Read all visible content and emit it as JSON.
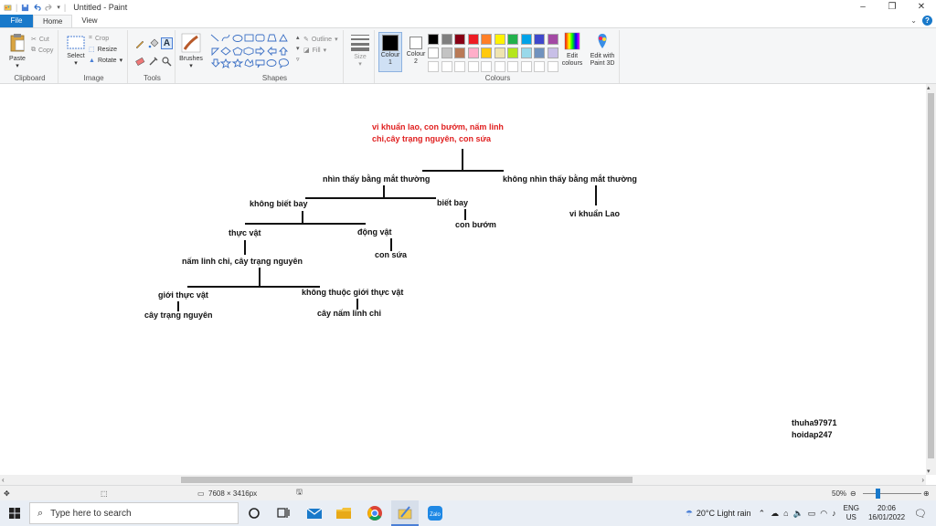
{
  "window": {
    "title": "Untitled - Paint",
    "minimize": "–",
    "restore": "❐",
    "close": "✕"
  },
  "tabs": {
    "file": "File",
    "home": "Home",
    "view": "View"
  },
  "ribbon": {
    "clipboard": {
      "label": "Clipboard",
      "paste": "Paste",
      "cut": "Cut",
      "copy": "Copy"
    },
    "image": {
      "label": "Image",
      "select": "Select",
      "crop": "Crop",
      "resize": "Resize",
      "rotate": "Rotate"
    },
    "tools": {
      "label": "Tools"
    },
    "brushes": "Brushes",
    "shapes": {
      "label": "Shapes",
      "outline": "Outline",
      "fill": "Fill"
    },
    "size": "Size",
    "colours": {
      "label": "Colours",
      "colour1": "Colour 1",
      "colour2": "Colour 2",
      "edit": "Edit colours",
      "paint3d": "Edit with Paint 3D",
      "palette_row1": [
        "#000000",
        "#7f7f7f",
        "#880015",
        "#ed1c24",
        "#ff7f27",
        "#fff200",
        "#22b14c",
        "#00a2e8",
        "#3f48cc",
        "#a349a4"
      ],
      "palette_row2": [
        "#ffffff",
        "#c3c3c3",
        "#b97a57",
        "#ffaec9",
        "#ffc90e",
        "#efe4b0",
        "#b5e61d",
        "#99d9ea",
        "#7092be",
        "#c8bfe7"
      ]
    }
  },
  "canvas": {
    "root_line1": "vi khuẩn lao, con bướm, nấm linh",
    "root_line2": "chi,cây trạng nguyên, con sứa",
    "visible": "nhìn thấy bằng mắt thường",
    "invisible": "không nhìn thấy bằng mắt thường",
    "no_fly": "không biết bay",
    "fly": "biết bay",
    "butterfly": "con bướm",
    "tb": "vi khuẩn Lao",
    "plant": "thực vật",
    "animal": "động vật",
    "jellyfish": "con sứa",
    "mushroom_group": "nấm linh chi, cây trạng nguyên",
    "plant_kingdom": "giới thực vật",
    "not_plant_kingdom": "không thuộc giới thực vật",
    "poinsettia": "cây trạng nguyên",
    "reishi": "cây nấm linh chi",
    "sig1": "thuha97971",
    "sig2": "hoidap247"
  },
  "status": {
    "dimensions": "7608 × 3416px",
    "zoom": "50%"
  },
  "taskbar": {
    "search_placeholder": "Type here to search",
    "weather": "20°C  Light rain",
    "lang1": "ENG",
    "lang2": "US",
    "time": "20:06",
    "date": "16/01/2022"
  }
}
